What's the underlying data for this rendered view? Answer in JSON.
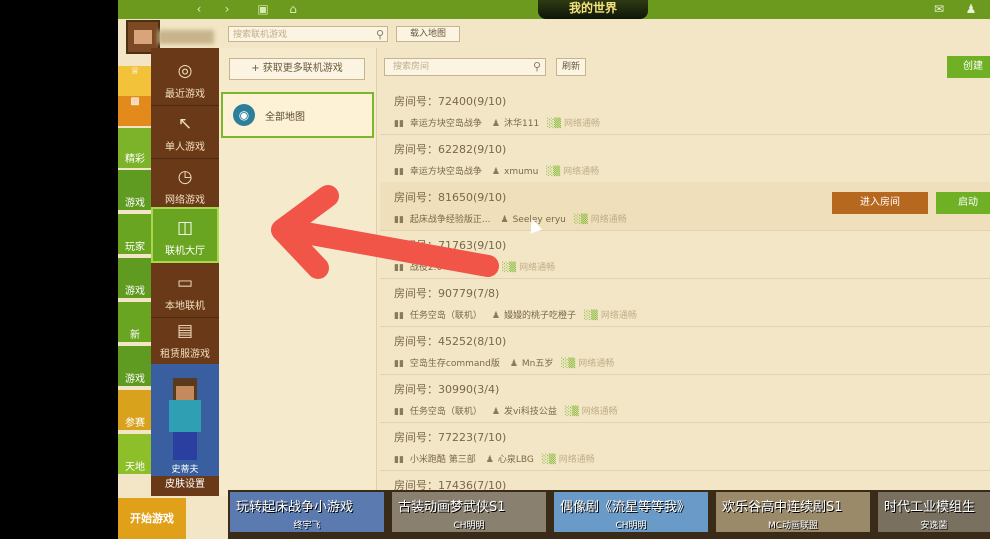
{
  "colors": {
    "accent_green": "#6fb024",
    "menu_brown": "#6a3a18",
    "enter_orange": "#b7681f",
    "panel_cream": "#f3e6c6",
    "annotation_red": "#f05548"
  },
  "topbar": {
    "logo_text": "我的世界",
    "mail_icon": "mail-icon",
    "user_icon": "user-icon"
  },
  "left_strip": {
    "items": [
      "精彩",
      "游戏",
      "玩家",
      "游戏",
      "新",
      "游戏",
      "参赛",
      "天地"
    ]
  },
  "menu": {
    "items": [
      {
        "label": "最近游戏",
        "icon": "gamepad-icon"
      },
      {
        "label": "单人游戏",
        "icon": "arrow-icon"
      },
      {
        "label": "网络游戏",
        "icon": "network-icon"
      },
      {
        "label": "联机大厅",
        "icon": "lobby-icon"
      },
      {
        "label": "本地联机",
        "icon": "monitor-icon"
      },
      {
        "label": "租赁服游戏",
        "icon": "list-icon"
      }
    ],
    "skin_name": "史蒂夫",
    "skin_settings": "皮肤设置",
    "start_game": "开始游戏"
  },
  "search": {
    "game_placeholder": "搜索联机游戏",
    "load_map": "载入地图",
    "room_placeholder": "搜索房间",
    "refresh": "刷新",
    "create": "创建"
  },
  "maps": {
    "get_more": "+ 获取更多联机游戏",
    "all_maps": "全部地图"
  },
  "rooms": [
    {
      "title": "房间号：72400(9/10)",
      "game": "幸运方块空岛战争",
      "owner": "沐华111",
      "net": "网络通畅"
    },
    {
      "title": "房间号：62282(9/10)",
      "game": "幸运方块空岛战争",
      "owner": "xmumu",
      "net": "网络通畅"
    },
    {
      "title": "房间号：81650(9/10)",
      "game": "起床战争经验版正...",
      "owner": "Seeley eryu",
      "net": "网络通畅",
      "enter": "进入房间",
      "launch": "启动"
    },
    {
      "title": "房间号：71763(9/10)",
      "game": "战役2.0",
      "owner": "",
      "net": "网络通畅"
    },
    {
      "title": "房间号：90779(7/8)",
      "game": "任务空岛（联机）",
      "owner": "嫚嫚的桃子吃橙子",
      "net": "网络通畅"
    },
    {
      "title": "房间号：45252(8/10)",
      "game": "空岛生存command版",
      "owner": "Mn五岁",
      "net": "网络通畅"
    },
    {
      "title": "房间号：30990(3/4)",
      "game": "任务空岛（联机）",
      "owner": "发vi科技公益",
      "net": "网络通畅"
    },
    {
      "title": "房间号：77223(7/10)",
      "game": "小米跑酷 第三部",
      "owner": "心泉LBG",
      "net": "网络通畅"
    },
    {
      "title": "房间号：17436(7/10)",
      "game": "",
      "owner": "",
      "net": ""
    }
  ],
  "banner": [
    {
      "title": "玩转起床战争小游戏",
      "sub": "终宇飞",
      "color": "#5a7ab0"
    },
    {
      "title": "古装动画梦武侠S1",
      "sub": "CH明明",
      "color": "#8a8070"
    },
    {
      "title": "偶像剧《流星等等我》",
      "sub": "CH明明",
      "color": "#6a9ac8"
    },
    {
      "title": "欢乐谷高中连续剧S1",
      "sub": "MC动画联盟",
      "color": "#9a8a6a"
    },
    {
      "title": "时代工业模组生",
      "sub": "安逸菌",
      "color": "#7a7060"
    }
  ]
}
